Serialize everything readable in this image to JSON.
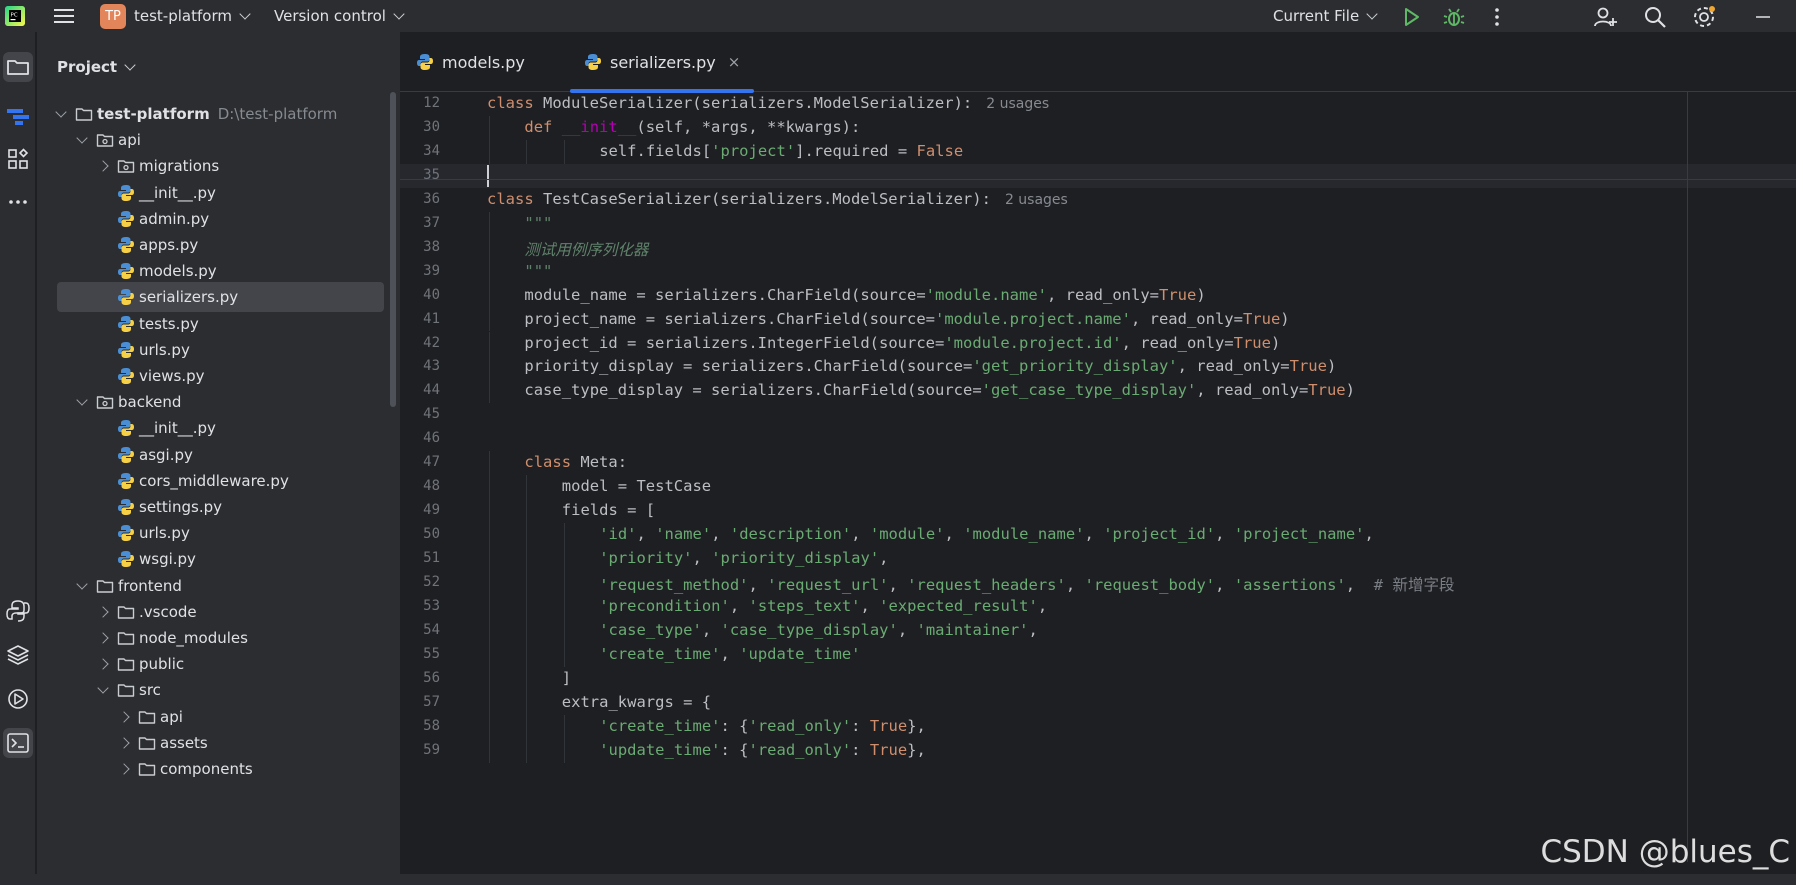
{
  "titlebar": {
    "project_badge": "TP",
    "project_name": "test-platform",
    "vcs_label": "Version control",
    "run_config": "Current File"
  },
  "project_panel": {
    "title": "Project",
    "tree": [
      {
        "label": "test-platform",
        "hint": "D:\\test-platform",
        "type": "folder",
        "depth": 0,
        "expanded": true,
        "bold": true
      },
      {
        "label": "api",
        "type": "package",
        "depth": 1,
        "expanded": true
      },
      {
        "label": "migrations",
        "type": "package",
        "depth": 2,
        "expanded": false
      },
      {
        "label": "__init__.py",
        "type": "py",
        "depth": 3
      },
      {
        "label": "admin.py",
        "type": "py",
        "depth": 3
      },
      {
        "label": "apps.py",
        "type": "py",
        "depth": 3
      },
      {
        "label": "models.py",
        "type": "py",
        "depth": 3
      },
      {
        "label": "serializers.py",
        "type": "py",
        "depth": 3,
        "selected": true
      },
      {
        "label": "tests.py",
        "type": "py",
        "depth": 3
      },
      {
        "label": "urls.py",
        "type": "py",
        "depth": 3
      },
      {
        "label": "views.py",
        "type": "py",
        "depth": 3
      },
      {
        "label": "backend",
        "type": "package",
        "depth": 1,
        "expanded": true
      },
      {
        "label": "__init__.py",
        "type": "py",
        "depth": 3
      },
      {
        "label": "asgi.py",
        "type": "py",
        "depth": 3
      },
      {
        "label": "cors_middleware.py",
        "type": "py",
        "depth": 3
      },
      {
        "label": "settings.py",
        "type": "py",
        "depth": 3
      },
      {
        "label": "urls.py",
        "type": "py",
        "depth": 3
      },
      {
        "label": "wsgi.py",
        "type": "py",
        "depth": 3
      },
      {
        "label": "frontend",
        "type": "folder",
        "depth": 1,
        "expanded": true
      },
      {
        "label": ".vscode",
        "type": "folder",
        "depth": 2,
        "expanded": false
      },
      {
        "label": "node_modules",
        "type": "folder",
        "depth": 2,
        "expanded": false
      },
      {
        "label": "public",
        "type": "folder",
        "depth": 2,
        "expanded": false
      },
      {
        "label": "src",
        "type": "folder",
        "depth": 2,
        "expanded": true
      },
      {
        "label": "api",
        "type": "folder",
        "depth": 3,
        "expanded": false
      },
      {
        "label": "assets",
        "type": "folder",
        "depth": 3,
        "expanded": false
      },
      {
        "label": "components",
        "type": "folder",
        "depth": 3,
        "expanded": false
      }
    ]
  },
  "tabs": [
    {
      "label": "models.py",
      "active": false
    },
    {
      "label": "serializers.py",
      "active": true,
      "close": "×"
    }
  ],
  "code_lines": [
    {
      "n": "12",
      "tokens": [
        [
          "kw",
          "class "
        ],
        [
          "",
          "ModuleSerializer(serializers.ModelSerializer):"
        ],
        [
          "usage",
          "2 usages"
        ]
      ],
      "indent": 0
    },
    {
      "n": "30",
      "tokens": [
        [
          "kw",
          "def "
        ],
        [
          "dunder",
          "__init__"
        ],
        [
          "",
          "(self, *args, **kwargs):"
        ]
      ],
      "indent": 1
    },
    {
      "n": "34",
      "tokens": [
        [
          "",
          "self.fields["
        ],
        [
          "str",
          "'project'"
        ],
        [
          "",
          "].required = "
        ],
        [
          "kw",
          "False"
        ]
      ],
      "indent": 3
    },
    {
      "n": "35",
      "tokens": [],
      "indent": 0,
      "current": true
    },
    {
      "n": "36",
      "tokens": [
        [
          "kw",
          "class "
        ],
        [
          "",
          "TestCaseSerializer(serializers.ModelSerializer):"
        ],
        [
          "usage",
          "2 usages"
        ]
      ],
      "indent": 0
    },
    {
      "n": "37",
      "tokens": [
        [
          "doc",
          "\"\"\""
        ]
      ],
      "indent": 1
    },
    {
      "n": "38",
      "tokens": [
        [
          "doc",
          "测试用例序列化器"
        ]
      ],
      "indent": 1
    },
    {
      "n": "39",
      "tokens": [
        [
          "doc",
          "\"\"\""
        ]
      ],
      "indent": 1
    },
    {
      "n": "40",
      "tokens": [
        [
          "",
          "module_name = serializers.CharField(source="
        ],
        [
          "str",
          "'module.name'"
        ],
        [
          "",
          ", read_only="
        ],
        [
          "kw",
          "True"
        ],
        [
          "",
          ")"
        ]
      ],
      "indent": 1
    },
    {
      "n": "41",
      "tokens": [
        [
          "",
          "project_name = serializers.CharField(source="
        ],
        [
          "str",
          "'module.project.name'"
        ],
        [
          "",
          ", read_only="
        ],
        [
          "kw",
          "True"
        ],
        [
          "",
          ")"
        ]
      ],
      "indent": 1
    },
    {
      "n": "42",
      "tokens": [
        [
          "",
          "project_id = serializers.IntegerField(source="
        ],
        [
          "str",
          "'module.project.id'"
        ],
        [
          "",
          ", read_only="
        ],
        [
          "kw",
          "True"
        ],
        [
          "",
          ")"
        ]
      ],
      "indent": 1
    },
    {
      "n": "43",
      "tokens": [
        [
          "",
          "priority_display = serializers.CharField(source="
        ],
        [
          "str",
          "'get_priority_display'"
        ],
        [
          "",
          ", read_only="
        ],
        [
          "kw",
          "True"
        ],
        [
          "",
          ")"
        ]
      ],
      "indent": 1
    },
    {
      "n": "44",
      "tokens": [
        [
          "",
          "case_type_display = serializers.CharField(source="
        ],
        [
          "str",
          "'get_case_type_display'"
        ],
        [
          "",
          ", read_only="
        ],
        [
          "kw",
          "True"
        ],
        [
          "",
          ")"
        ]
      ],
      "indent": 1
    },
    {
      "n": "45",
      "tokens": [],
      "indent": 0
    },
    {
      "n": "46",
      "tokens": [],
      "indent": 0
    },
    {
      "n": "47",
      "tokens": [
        [
          "kw",
          "class "
        ],
        [
          "",
          "Meta:"
        ]
      ],
      "indent": 1
    },
    {
      "n": "48",
      "tokens": [
        [
          "",
          "model = TestCase"
        ]
      ],
      "indent": 2
    },
    {
      "n": "49",
      "tokens": [
        [
          "",
          "fields = ["
        ]
      ],
      "indent": 2
    },
    {
      "n": "50",
      "tokens": [
        [
          "str",
          "'id'"
        ],
        [
          "",
          ", "
        ],
        [
          "str",
          "'name'"
        ],
        [
          "",
          ", "
        ],
        [
          "str",
          "'description'"
        ],
        [
          "",
          ", "
        ],
        [
          "str",
          "'module'"
        ],
        [
          "",
          ", "
        ],
        [
          "str",
          "'module_name'"
        ],
        [
          "",
          ", "
        ],
        [
          "str",
          "'project_id'"
        ],
        [
          "",
          ", "
        ],
        [
          "str",
          "'project_name'"
        ],
        [
          "",
          ","
        ]
      ],
      "indent": 3
    },
    {
      "n": "51",
      "tokens": [
        [
          "str",
          "'priority'"
        ],
        [
          "",
          ", "
        ],
        [
          "str",
          "'priority_display'"
        ],
        [
          "",
          ","
        ]
      ],
      "indent": 3
    },
    {
      "n": "52",
      "tokens": [
        [
          "str",
          "'request_method'"
        ],
        [
          "",
          ", "
        ],
        [
          "str",
          "'request_url'"
        ],
        [
          "",
          ", "
        ],
        [
          "str",
          "'request_headers'"
        ],
        [
          "",
          ", "
        ],
        [
          "str",
          "'request_body'"
        ],
        [
          "",
          ", "
        ],
        [
          "str",
          "'assertions'"
        ],
        [
          "",
          ",  "
        ],
        [
          "cm",
          "# 新增字段"
        ]
      ],
      "indent": 3
    },
    {
      "n": "53",
      "tokens": [
        [
          "str",
          "'precondition'"
        ],
        [
          "",
          ", "
        ],
        [
          "str",
          "'steps_text'"
        ],
        [
          "",
          ", "
        ],
        [
          "str",
          "'expected_result'"
        ],
        [
          "",
          ","
        ]
      ],
      "indent": 3
    },
    {
      "n": "54",
      "tokens": [
        [
          "str",
          "'case_type'"
        ],
        [
          "",
          ", "
        ],
        [
          "str",
          "'case_type_display'"
        ],
        [
          "",
          ", "
        ],
        [
          "str",
          "'maintainer'"
        ],
        [
          "",
          ","
        ]
      ],
      "indent": 3
    },
    {
      "n": "55",
      "tokens": [
        [
          "str",
          "'create_time'"
        ],
        [
          "",
          ", "
        ],
        [
          "str",
          "'update_time'"
        ]
      ],
      "indent": 3
    },
    {
      "n": "56",
      "tokens": [
        [
          "",
          "]"
        ]
      ],
      "indent": 2
    },
    {
      "n": "57",
      "tokens": [
        [
          "",
          "extra_kwargs = {"
        ]
      ],
      "indent": 2
    },
    {
      "n": "58",
      "tokens": [
        [
          "str",
          "'create_time'"
        ],
        [
          "",
          ": {"
        ],
        [
          "str",
          "'read_only'"
        ],
        [
          "",
          ": "
        ],
        [
          "kw",
          "True"
        ],
        [
          "",
          "},"
        ]
      ],
      "indent": 3
    },
    {
      "n": "59",
      "tokens": [
        [
          "str",
          "'update_time'"
        ],
        [
          "",
          ": {"
        ],
        [
          "str",
          "'read_only'"
        ],
        [
          "",
          ": "
        ],
        [
          "kw",
          "True"
        ],
        [
          "",
          "},"
        ]
      ],
      "indent": 3
    }
  ],
  "watermark": "CSDN @blues_C",
  "colors": {
    "accent": "#3574f0",
    "keyword": "#cf8e6d",
    "string": "#6aab73",
    "run_green": "#5fb865"
  }
}
